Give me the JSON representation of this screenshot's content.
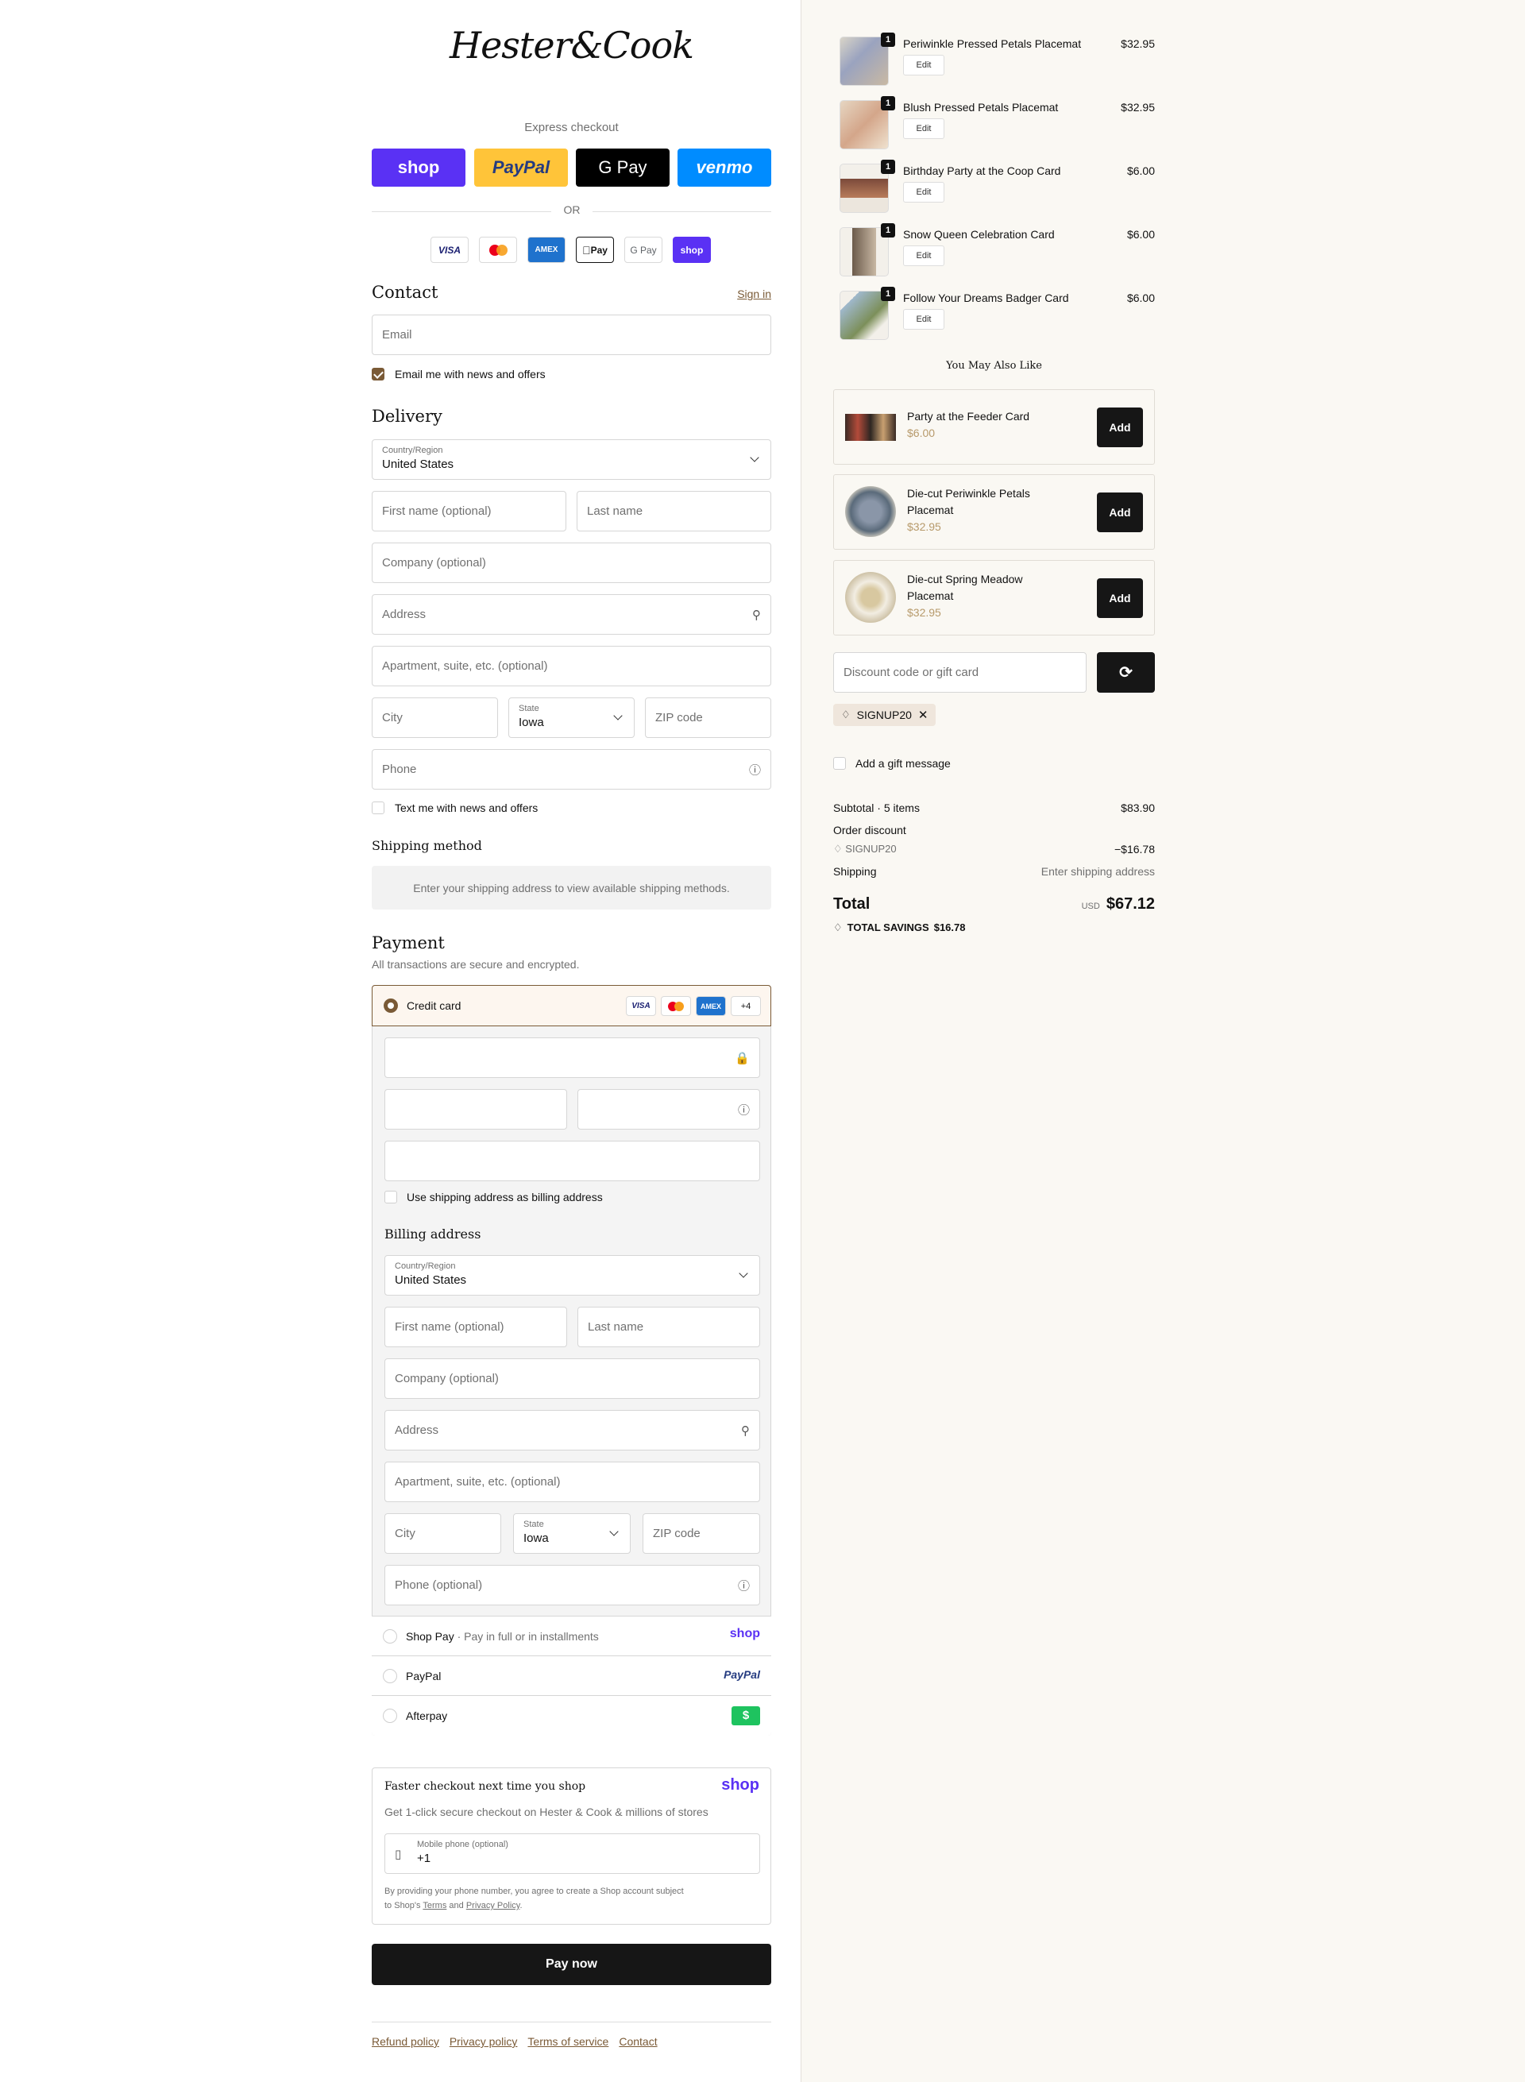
{
  "brand": {
    "logo_text": "Hester&Cook"
  },
  "express": {
    "label": "Express checkout",
    "shop": "shop",
    "paypal": "PayPal",
    "gpay": "G Pay",
    "venmo": "venmo",
    "or": "OR"
  },
  "accepted_cards": [
    "VISA",
    "MC",
    "AMEX",
    "Pay",
    "G Pay",
    "shop"
  ],
  "contact": {
    "title": "Contact",
    "sign_in": "Sign in",
    "email_placeholder": "Email",
    "newsletter_label": "Email me with news and offers"
  },
  "delivery": {
    "title": "Delivery",
    "country_label": "Country/Region",
    "country_value": "United States",
    "first_name": "First name (optional)",
    "last_name": "Last name",
    "company": "Company (optional)",
    "address": "Address",
    "apartment": "Apartment, suite, etc. (optional)",
    "city": "City",
    "state_label": "State",
    "state_value": "Iowa",
    "zip": "ZIP code",
    "phone": "Phone",
    "sms_label": "Text me with news and offers"
  },
  "shipping_method": {
    "title": "Shipping method",
    "notice": "Enter your shipping address to view available shipping methods."
  },
  "payment": {
    "title": "Payment",
    "subtitle": "All transactions are secure and encrypted.",
    "credit_card": "Credit card",
    "more_cards": "+4",
    "use_shipping_label": "Use shipping address as billing address",
    "billing_title": "Billing address",
    "billing": {
      "country_label": "Country/Region",
      "country_value": "United States",
      "first_name": "First name (optional)",
      "last_name": "Last name",
      "company": "Company (optional)",
      "address": "Address",
      "apartment": "Apartment, suite, etc. (optional)",
      "city": "City",
      "state_label": "State",
      "state_value": "Iowa",
      "zip": "ZIP code",
      "phone": "Phone (optional)"
    },
    "shop_pay": "Shop Pay",
    "shop_pay_sub": "· Pay in full or in installments",
    "shop_logo": "shop",
    "paypal": "PayPal",
    "paypal_logo": "PayPal",
    "afterpay": "Afterpay",
    "afterpay_logo": "$"
  },
  "shop_signup": {
    "title": "Faster checkout next time you shop",
    "logo": "shop",
    "subtitle": "Get 1-click secure checkout on Hester & Cook & millions of stores",
    "phone_label": "Mobile phone (optional)",
    "phone_value": "+1",
    "disclaimer_1": "By providing your phone number, you agree to create a Shop account subject",
    "disclaimer_2_pre": "to Shop's ",
    "terms": "Terms",
    "and": " and ",
    "privacy": "Privacy Policy",
    "period": "."
  },
  "pay_now": "Pay now",
  "footer": [
    "Refund policy",
    "Privacy policy",
    "Terms of service",
    "Contact"
  ],
  "cart": {
    "items": [
      {
        "name": "Periwinkle Pressed Petals Placemat",
        "price": "$32.95",
        "qty": "1",
        "edit": "Edit"
      },
      {
        "name": "Blush Pressed Petals Placemat",
        "price": "$32.95",
        "qty": "1",
        "edit": "Edit"
      },
      {
        "name": "Birthday Party at the Coop Card",
        "price": "$6.00",
        "qty": "1",
        "edit": "Edit"
      },
      {
        "name": "Snow Queen Celebration Card",
        "price": "$6.00",
        "qty": "1",
        "edit": "Edit"
      },
      {
        "name": "Follow Your Dreams Badger Card",
        "price": "$6.00",
        "qty": "1",
        "edit": "Edit"
      }
    ],
    "upsell_title": "You May Also Like",
    "upsell": [
      {
        "name_1": "Party at the Feeder Card",
        "name_2": "",
        "price": "$6.00",
        "add": "Add"
      },
      {
        "name_1": "Die-cut Periwinkle Petals",
        "name_2": "Placemat",
        "price": "$32.95",
        "add": "Add"
      },
      {
        "name_1": "Die-cut Spring Meadow",
        "name_2": "Placemat",
        "price": "$32.95",
        "add": "Add"
      }
    ],
    "discount_placeholder": "Discount code or gift card",
    "applied_code": "SIGNUP20",
    "gift_message": "Add a gift message",
    "subtotal_label": "Subtotal · 5 items",
    "subtotal_value": "$83.90",
    "order_discount_label": "Order discount",
    "discount_code": "SIGNUP20",
    "discount_value": "−$16.78",
    "shipping_label": "Shipping",
    "shipping_value": "Enter shipping address",
    "total_label": "Total",
    "currency": "USD",
    "total_value": "$67.12",
    "savings_label": "TOTAL SAVINGS",
    "savings_value": "$16.78"
  },
  "colors": {
    "accent": "#7a5a36",
    "shop_purple": "#5a31f4",
    "paypal_yellow": "#ffc439",
    "venmo_blue": "#008cff",
    "right_bg": "#faf8f3"
  }
}
